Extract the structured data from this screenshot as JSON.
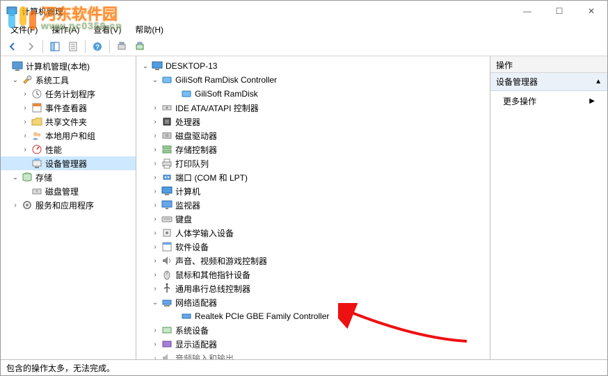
{
  "window": {
    "title": "计算机管理",
    "min": "—",
    "max": "☐",
    "close": "✕"
  },
  "menu": {
    "file": "文件(F)",
    "action": "操作(A)",
    "view": "查看(V)",
    "help": "帮助(H)"
  },
  "left_tree": {
    "root": "计算机管理(本地)",
    "system_tools": "系统工具",
    "task_scheduler": "任务计划程序",
    "event_viewer": "事件查看器",
    "shared_folders": "共享文件夹",
    "local_users": "本地用户和组",
    "performance": "性能",
    "device_manager": "设备管理器",
    "storage": "存储",
    "disk_management": "磁盘管理",
    "services_apps": "服务和应用程序"
  },
  "device_tree": {
    "computer": "DESKTOP-13",
    "ramdisk_ctrl": "GiliSoft RamDisk Controller",
    "ramdisk": "GiliSoft RamDisk",
    "ide": "IDE ATA/ATAPI 控制器",
    "cpu": "处理器",
    "disk_drives": "磁盘驱动器",
    "storage_ctrl": "存储控制器",
    "print_queue": "打印队列",
    "ports": "端口 (COM 和 LPT)",
    "computers": "计算机",
    "monitors": "监视器",
    "keyboards": "键盘",
    "hid": "人体学输入设备",
    "software_devices": "软件设备",
    "sound": "声音、视频和游戏控制器",
    "mice": "鼠标和其他指针设备",
    "usb": "通用串行总线控制器",
    "network": "网络适配器",
    "network_device": "Realtek PCIe GBE Family Controller",
    "system_devices": "系统设备",
    "display": "显示适配器",
    "audio_io": "音频输入和输出"
  },
  "actions": {
    "header": "操作",
    "section": "设备管理器",
    "more": "更多操作"
  },
  "status": "包含的操作太多，无法完成。",
  "watermark": {
    "name": "河东软件园",
    "url": "www.pc0359.cn"
  }
}
